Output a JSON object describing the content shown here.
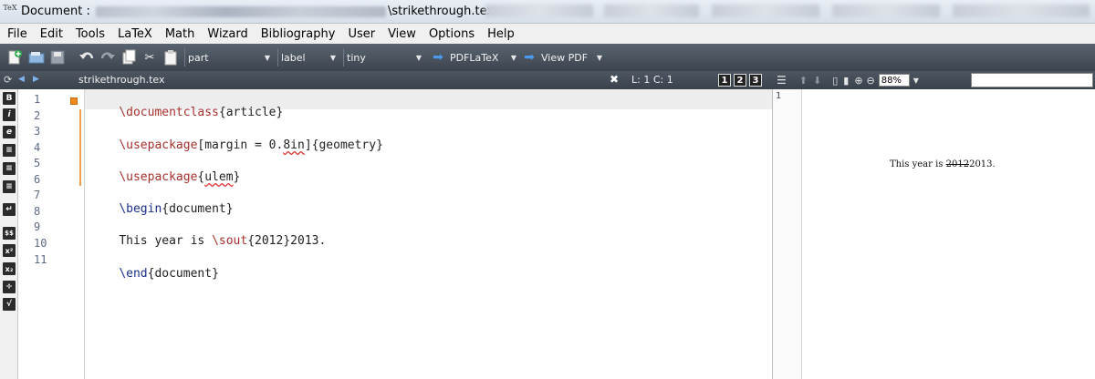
{
  "window": {
    "title_prefix": "Document : ",
    "title_file": "\\strikethrough.tex",
    "app_icon_text": "TeX"
  },
  "menu": [
    "File",
    "Edit",
    "Tools",
    "LaTeX",
    "Math",
    "Wizard",
    "Bibliography",
    "User",
    "View",
    "Options",
    "Help"
  ],
  "toolbar": {
    "structure_combo": "part",
    "label_combo": "label",
    "size_combo": "tiny",
    "compile_label": "PDFLaTeX",
    "view_label": "View PDF"
  },
  "tab": {
    "filename": "strikethrough.tex",
    "position": "L: 1 C: 1",
    "num_buttons": [
      "1",
      "2",
      "3"
    ]
  },
  "pdf_toolbar": {
    "zoom": "88%"
  },
  "editor": {
    "line_numbers": [
      "1",
      "2",
      "3",
      "4",
      "5",
      "6",
      "7",
      "8",
      "9",
      "10",
      "11"
    ],
    "lines": {
      "l1_cmd": "\\documentclass",
      "l1_arg": "{article}",
      "l3_cmd": "\\usepackage",
      "l3_opt_a": "[margin = 0.",
      "l3_opt_b": "8in",
      "l3_opt_c": "]{geometry}",
      "l5_cmd": "\\usepackage",
      "l5_open": "{",
      "l5_arg": "ulem",
      "l5_close": "}",
      "l7_cmd": "\\begin",
      "l7_arg": "{document}",
      "l9_text": "This year is ",
      "l9_cmd": "\\sout",
      "l9_arg": "{2012}2013.",
      "l11_cmd": "\\end",
      "l11_arg": "{document}"
    }
  },
  "left_symbols": [
    "B",
    "i",
    "e",
    "≡",
    "≡",
    "≡",
    "↵",
    "$$",
    "x²",
    "x₂",
    "÷",
    "√"
  ],
  "pdf": {
    "page_number": "1",
    "text_before": "This year is ",
    "text_struck": "2012",
    "text_after": "2013."
  },
  "colors": {
    "keyword": "#a3302b",
    "environment_keyword": "#1a2f8c",
    "toolbar_bg": "#3c444e",
    "fold_marker": "#f08a1c"
  }
}
